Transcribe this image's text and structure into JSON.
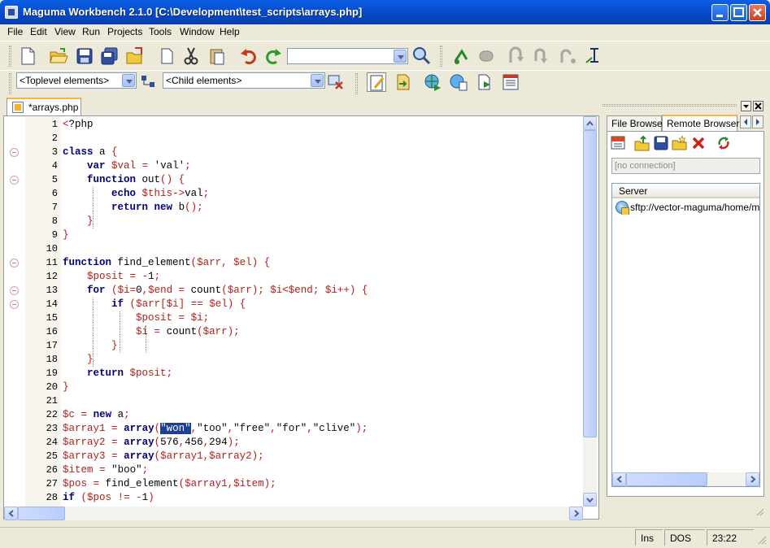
{
  "window": {
    "title": "Maguma Workbench 2.1.0 [C:\\Development\\test_scripts\\arrays.php]"
  },
  "menu": [
    "File",
    "Edit",
    "View",
    "Run",
    "Projects",
    "Tools",
    "Window",
    "Help"
  ],
  "toolbar": {
    "search_value": "",
    "toplevel_combo": "<Toplevel elements>",
    "child_combo": "<Child elements>"
  },
  "editor": {
    "tab_label": "*arrays.php",
    "lines": [
      "<?php",
      "",
      "class a {",
      "    var $val = 'val';",
      "    function out() {",
      "        echo $this->val;",
      "        return new b();",
      "    }",
      "}",
      "",
      "function find_element($arr, $el) {",
      "    $posit = -1;",
      "    for ($i=0,$end = count($arr); $i<$end; $i++) {",
      "        if ($arr[$i] == $el) {",
      "            $posit = $i;",
      "            $i = count($arr);",
      "        }",
      "    }",
      "    return $posit;",
      "}",
      "",
      "$c = new a;",
      "$array1 = array(\"won\",\"too\",\"free\",\"for\",\"clive\");",
      "$array2 = array(576,456,294);",
      "$array3 = array($array1,$array2);",
      "$item = \"boo\";",
      "$pos = find_element($array1,$item);",
      "if ($pos != -1)"
    ],
    "selected_text": "\"won\""
  },
  "remote_panel": {
    "tabs": [
      "File Browser",
      "Remote Browser"
    ],
    "active_tab": "Remote Browser",
    "connection_field": "[no connection]",
    "column_header": "Server",
    "servers": [
      "sftp://vector-maguma/home/mag"
    ]
  },
  "status": {
    "mode": "Ins",
    "line_endings": "DOS",
    "position": "23:22"
  }
}
